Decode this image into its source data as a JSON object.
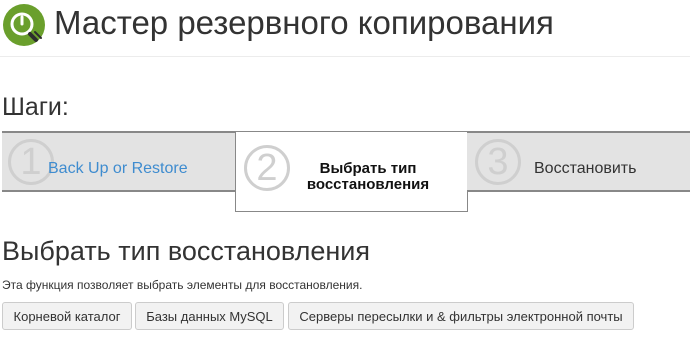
{
  "header": {
    "title": "Мастер резервного копирования"
  },
  "steps_heading": "Шаги:",
  "steps": [
    {
      "number": "1",
      "label": "Back Up or Restore"
    },
    {
      "number": "2",
      "label_line1": "Выбрать тип",
      "label_line2": "восстановления"
    },
    {
      "number": "3",
      "label": "Восстановить"
    }
  ],
  "section": {
    "title": "Выбрать тип восстановления",
    "description": "Эта функция позволяет выбрать элементы для восстановления."
  },
  "buttons": {
    "root_dir": "Корневой каталог",
    "mysql": "Базы данных MySQL",
    "forwarders": "Серверы пересылки и & фильтры электронной почты"
  },
  "colors": {
    "logo_green": "#6a9f2c",
    "link_blue": "#3f8ccf",
    "step_inactive_bg": "#e3e3e3"
  },
  "icons": {
    "logo": "backup-wizard-logo-icon"
  }
}
